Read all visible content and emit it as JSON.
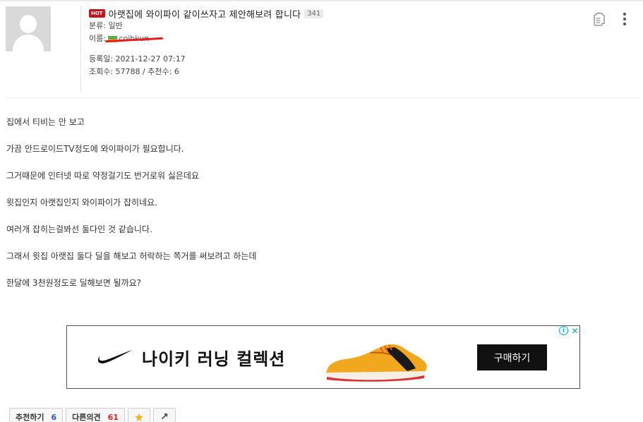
{
  "post": {
    "hot_badge": "HOT",
    "title": "아랫집에 와이파이 같이쓰자고 제안해보려 합니다",
    "comment_count": "341",
    "category_label": "분류: 일반",
    "name_label": "이름: ",
    "name_value": "coibkun",
    "registered": "등록일: 2021-12-27 07:17",
    "stats": "조회수: 57788 / 추천수: 6"
  },
  "content": {
    "lines": [
      "집에서 티비는 안 보고",
      "가끔 안드로이드TV정도에 와이파이가 필요합니다.",
      "그거때문에 인터넷 따로 약정걸기도 번거로워 싫은데요",
      "윗집인지 아랫집인지 와이파이가 잡히네요.",
      "여러개 잡히는걸봐선 둘다인 것 같습니다.",
      "그래서 윗집 아랫집 둘다 딜을 해보고 허락하는 쪽거를 써보려고 하는데",
      "한달에 3천원정도로 딜해보면 될까요?"
    ]
  },
  "ad": {
    "headline": "나이키 러닝 컬렉션",
    "button_label": "구매하기",
    "info_glyph": "i",
    "close_glyph": "✕"
  },
  "actions": {
    "recommend_label": "추천하기",
    "recommend_count": "6",
    "opinion_label": "다른의견",
    "opinion_count": "61",
    "star_glyph": "★",
    "share_glyph": "↗"
  },
  "icons": {
    "doc": "document-copy-icon",
    "more": "more-vertical-icon",
    "star": "star-icon",
    "share": "share-icon"
  },
  "colors": {
    "hot": "#c4161c",
    "redaction": "#e02020",
    "recommend_count": "#2b58a8",
    "opinion_count": "#d22222",
    "star": "#f2b01e"
  }
}
